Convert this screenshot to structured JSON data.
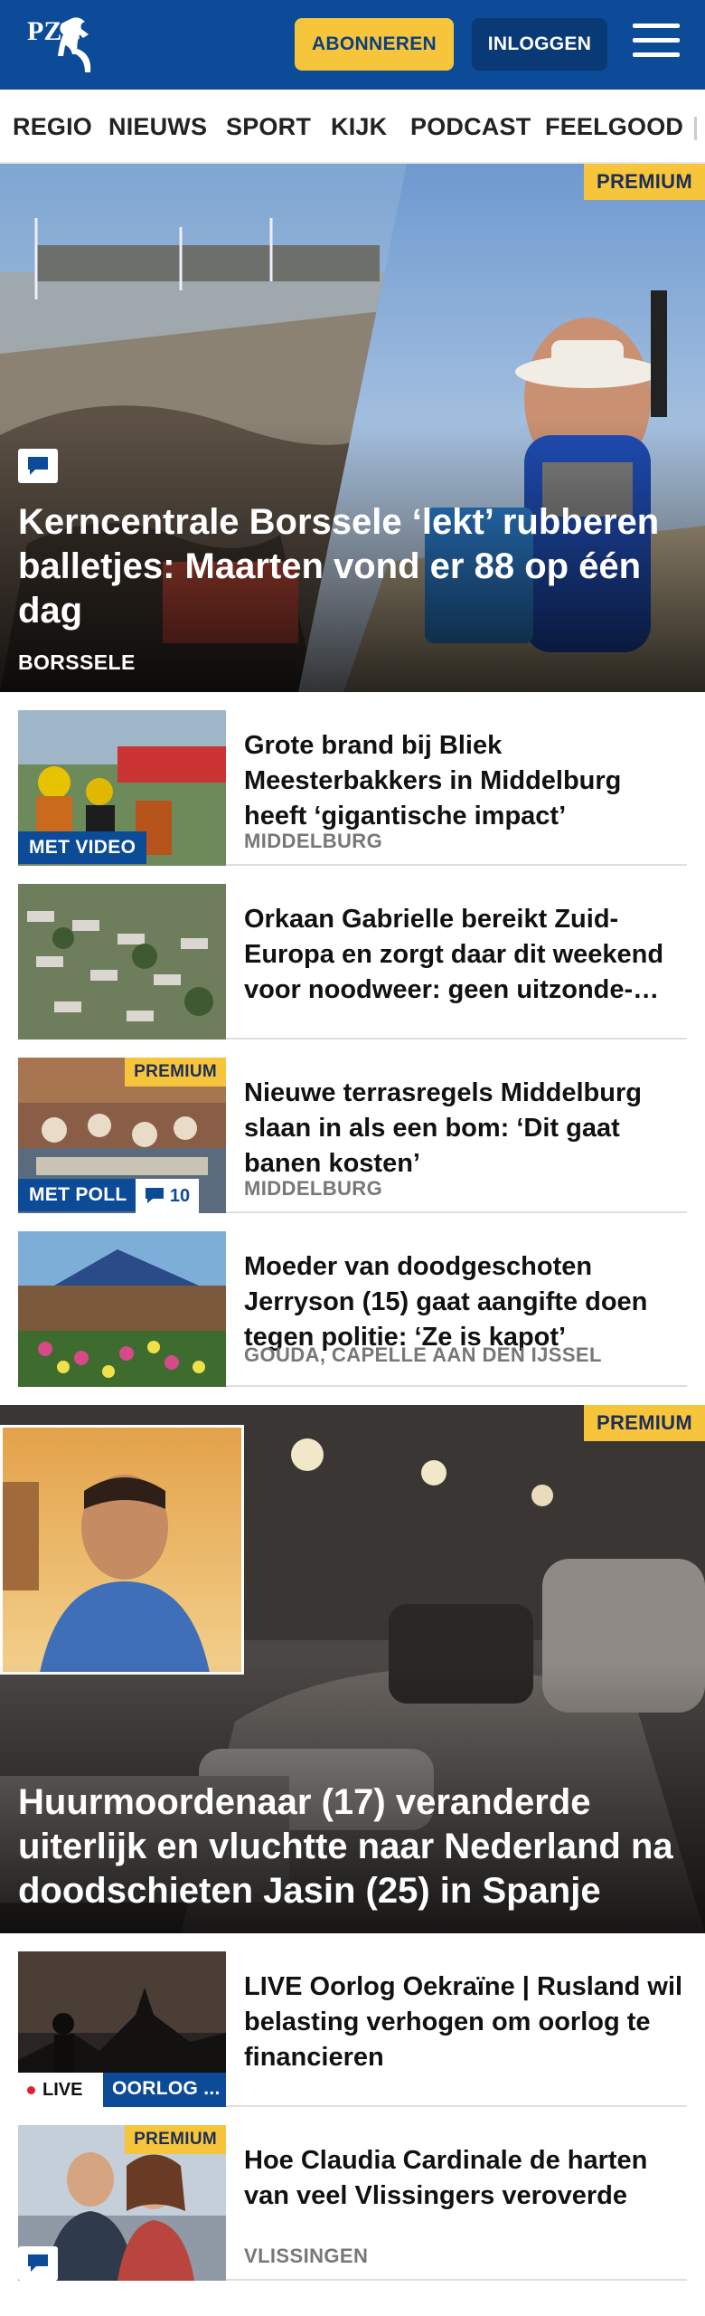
{
  "header": {
    "logo_text": "PZC",
    "subscribe_label": "ABONNEREN",
    "login_label": "INLOGGEN"
  },
  "nav": [
    "REGIO",
    "NIEUWS",
    "SPORT",
    "KIJK",
    "PODCAST",
    "FEELGOOD"
  ],
  "hero1": {
    "badge": "PREMIUM",
    "title": "Kerncentrale Borssele ‘lekt’ rubberen balletjes: Maarten vond er 88 op één dag",
    "location": "BORSSELE"
  },
  "articles": [
    {
      "title": "Grote brand bij Bliek Meesterbakkers in Middelburg heeft ‘gigantische impact’",
      "location": "MIDDELBURG",
      "tag": "MET VIDEO"
    },
    {
      "title": "Orkaan Gabrielle bereikt Zuid-Europa en zorgt daar dit weekend voor noodweer: geen uitzonde-…",
      "location": ""
    },
    {
      "title": "Nieuwe terrasregels Middelburg slaan in als een bom: ‘Dit gaat banen kosten’",
      "location": "MIDDELBURG",
      "badge": "PREMIUM",
      "tag": "MET POLL",
      "comments": "10"
    },
    {
      "title": "Moeder van doodgeschoten Jerryson (15) gaat aangifte doen tegen politie: ‘Ze is kapot’",
      "location": "GOUDA, CAPELLE AAN DEN IJSSEL"
    }
  ],
  "hero2": {
    "badge": "PREMIUM",
    "title": "Huurmoordenaar (17) veranderde uiterlijk en vluchtte naar Nederland na doodschieten Jasin (25) in Spanje"
  },
  "articles2": [
    {
      "title": "LIVE Oorlog Oekraïne | Rusland wil belasting verhogen om oorlog te financieren",
      "live_label": "LIVE",
      "tag": "OORLOG ..."
    },
    {
      "title": "Hoe Claudia Cardinale de harten van veel Vlissingers veroverde",
      "location": "VLISSINGEN",
      "badge": "PREMIUM"
    }
  ],
  "colors": {
    "brand_blue": "#0b4b98",
    "accent_yellow": "#f6c53b"
  }
}
